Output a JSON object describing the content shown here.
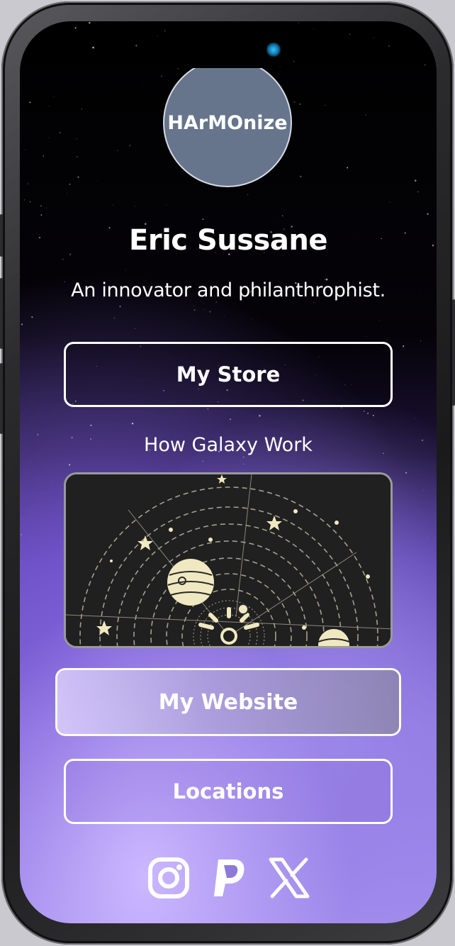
{
  "profile": {
    "avatar_text": "HArMOnize",
    "name": "Eric Sussane",
    "tagline": "An innovator and philanthrophist."
  },
  "links": {
    "store_label": "My Store",
    "section_title": "How Galaxy Work",
    "website_label": "My Website",
    "locations_label": "Locations"
  },
  "social": {
    "icons": [
      "instagram-icon",
      "paypal-icon",
      "x-icon"
    ]
  },
  "colors": {
    "avatar_bg": "#66758c",
    "text": "#ffffff",
    "accent_purple": "#8b72e0",
    "illustration_cream": "#f0e8c0"
  }
}
